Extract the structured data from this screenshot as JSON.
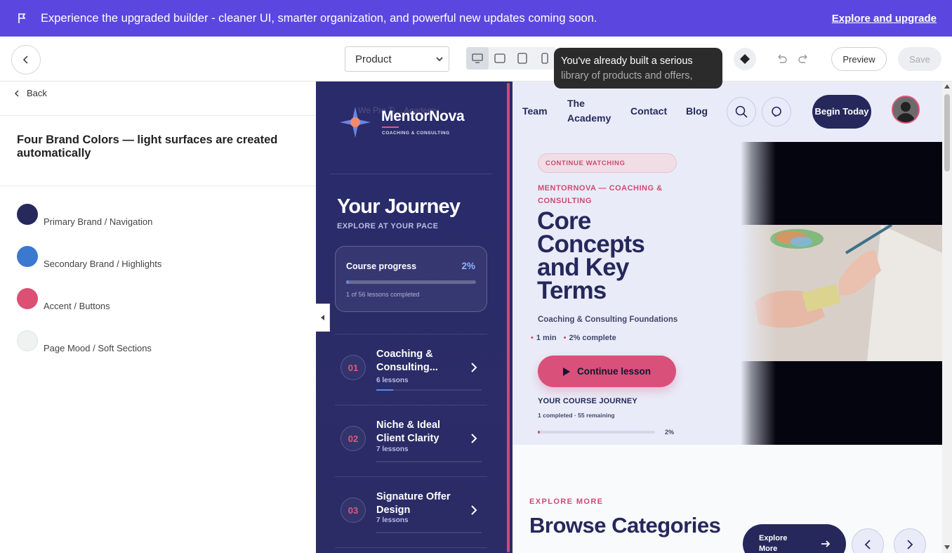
{
  "banner": {
    "message": "Experience the upgraded builder - cleaner UI, smarter organization, and powerful new updates coming soon.",
    "link": "Explore and upgrade",
    "icon": "flag-icon"
  },
  "toolbar": {
    "page_select": "Product",
    "devices": [
      "desktop-icon",
      "tablet-landscape-icon",
      "tablet-portrait-icon",
      "mobile-icon"
    ],
    "tooltip_line1": "You've already built a serious",
    "tooltip_line2": "library of products and offers,",
    "preview": "Preview",
    "save": "Save"
  },
  "left_panel": {
    "back": "Back",
    "heading": "Four Brand Colors — light surfaces are created automatically",
    "colors": [
      {
        "label": "Primary Brand / Navigation",
        "hex": "#27285c"
      },
      {
        "label": "Secondary Brand / Highlights",
        "hex": "#3b78d0"
      },
      {
        "label": "Accent / Buttons",
        "hex": "#dd4f74"
      },
      {
        "label": "Page Mood / Soft Sections",
        "hex": "#eef2f1"
      }
    ]
  },
  "course_sidebar": {
    "brand": "MentorNova",
    "brand_sub": "COACHING & CONSULTING",
    "ghost_nav": "We   Pro   Ti... Academy",
    "title": "Your Journey",
    "subtitle": "EXPLORE AT YOUR PACE",
    "progress_label": "Course progress",
    "progress_pct": "2%",
    "progress_value": 0.02,
    "progress_meta": "1 of 56 lessons completed",
    "modules": [
      {
        "num": "01",
        "title": "Coaching & Consulting...",
        "lessons": "6 lessons",
        "progress": 0.16
      },
      {
        "num": "02",
        "title": "Niche & Ideal Client Clarity",
        "lessons": "7 lessons",
        "progress": 0
      },
      {
        "num": "03",
        "title": "Signature Offer Design",
        "lessons": "7 lessons",
        "progress": 0
      }
    ]
  },
  "site_nav": {
    "items": [
      "Team",
      "The Academy",
      "Contact",
      "Blog"
    ],
    "cta": "Begin Today"
  },
  "lesson": {
    "chip": "CONTINUE WATCHING",
    "eyebrow": "MENTORNOVA — COACHING & CONSULTING",
    "title": "Core Concepts and Key Terms",
    "course": "Coaching & Consulting Foundations",
    "duration": "1 min",
    "complete": "2% complete",
    "button": "Continue lesson",
    "journey_title": "YOUR COURSE JOURNEY",
    "journey_meta": "1 completed · 55 remaining",
    "journey_pct": "2%",
    "journey_value": 0.02
  },
  "explore": {
    "eyebrow": "EXPLORE MORE",
    "title": "Browse Categories",
    "button": "Explore More"
  }
}
